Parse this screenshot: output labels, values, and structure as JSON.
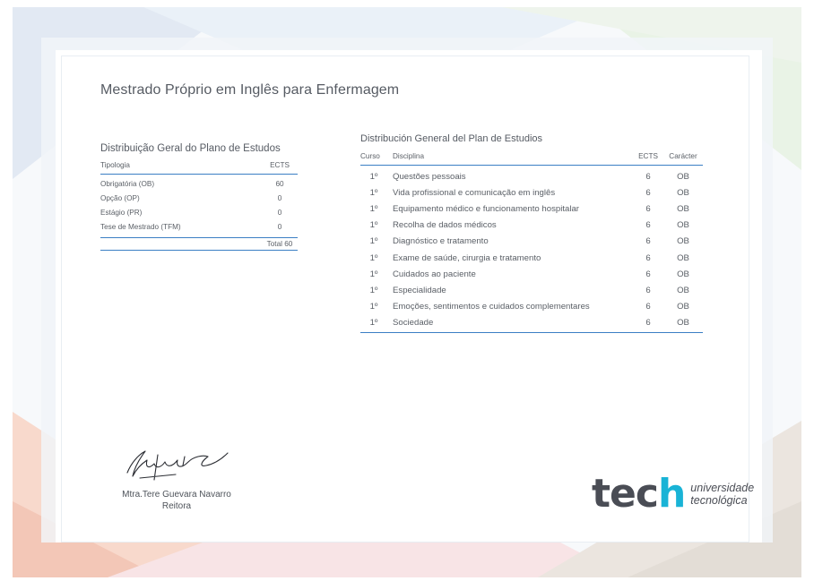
{
  "title": "Mestrado Próprio em Inglês para Enfermagem",
  "left_table": {
    "title": "Distribuição Geral do Plano de Estudos",
    "headers": [
      "Tipologia",
      "ECTS"
    ],
    "rows": [
      {
        "type": "Obrigatória (OB)",
        "ects": "60"
      },
      {
        "type": "Opção (OP)",
        "ects": "0"
      },
      {
        "type": "Estágio (PR)",
        "ects": "0"
      },
      {
        "type": "Tese de Mestrado (TFM)",
        "ects": "0"
      }
    ],
    "total": "Total 60"
  },
  "right_table": {
    "title": "Distribución General del Plan de Estudios",
    "headers": [
      "Curso",
      "Disciplina",
      "ECTS",
      "Carácter"
    ],
    "rows": [
      {
        "curso": "1º",
        "disciplina": "Questões pessoais",
        "ects": "6",
        "caracter": "OB"
      },
      {
        "curso": "1º",
        "disciplina": "Vida profissional e comunicação em inglês",
        "ects": "6",
        "caracter": "OB"
      },
      {
        "curso": "1º",
        "disciplina": "Equipamento médico e funcionamento hospitalar",
        "ects": "6",
        "caracter": "OB"
      },
      {
        "curso": "1º",
        "disciplina": "Recolha de dados médicos",
        "ects": "6",
        "caracter": "OB"
      },
      {
        "curso": "1º",
        "disciplina": "Diagnóstico e tratamento",
        "ects": "6",
        "caracter": "OB"
      },
      {
        "curso": "1º",
        "disciplina": "Exame de saúde, cirurgia e tratamento",
        "ects": "6",
        "caracter": "OB"
      },
      {
        "curso": "1º",
        "disciplina": "Cuidados ao paciente",
        "ects": "6",
        "caracter": "OB"
      },
      {
        "curso": "1º",
        "disciplina": "Especialidade",
        "ects": "6",
        "caracter": "OB"
      },
      {
        "curso": "1º",
        "disciplina": "Emoções, sentimentos e cuidados complementares",
        "ects": "6",
        "caracter": "OB"
      },
      {
        "curso": "1º",
        "disciplina": "Sociedade",
        "ects": "6",
        "caracter": "OB"
      }
    ]
  },
  "signature": {
    "name": "Mtra.Tere Guevara Navarro",
    "role": "Reitora"
  },
  "logo": {
    "word_main": "tec",
    "word_h": "h",
    "tag_line1": "universidade",
    "tag_line2": "tecnológica",
    "accent_color": "#19b3d6"
  }
}
